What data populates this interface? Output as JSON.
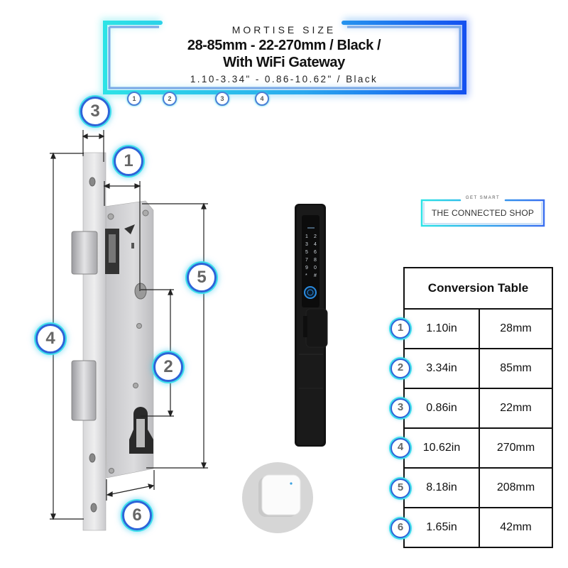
{
  "header": {
    "subtitle": "MORTISE SIZE",
    "title_line1": "28-85mm - 22-270mm / Black /",
    "title_line2": "With WiFi Gateway",
    "inch_line": "1.10-3.34\" - 0.86-10.62\" / Black",
    "mini_badges": [
      "1",
      "2",
      "3",
      "4"
    ],
    "frame_colors": {
      "left": "#2de3e6",
      "right": "#1552f0",
      "inner": "#6fa6e8"
    }
  },
  "logo": {
    "tagline": "GET SMART",
    "name": "THE CONNECTED SHOP"
  },
  "diagram": {
    "badges": [
      "1",
      "2",
      "3",
      "4",
      "5",
      "6"
    ],
    "images": {
      "mortise_lock": "mortise-lock-body",
      "smart_lock": "black-keypad-fingerprint-smart-lock",
      "gateway": "white-wifi-gateway"
    },
    "keypad_keys": [
      "1",
      "2",
      "3",
      "4",
      "5",
      "6",
      "7",
      "8",
      "9",
      "0",
      "*",
      "#"
    ]
  },
  "conversion_table": {
    "title": "Conversion Table",
    "rows": [
      {
        "badge": "1",
        "inches": "1.10in",
        "mm": "28mm"
      },
      {
        "badge": "2",
        "inches": "3.34in",
        "mm": "85mm"
      },
      {
        "badge": "3",
        "inches": "0.86in",
        "mm": "22mm"
      },
      {
        "badge": "4",
        "inches": "10.62in",
        "mm": "270mm"
      },
      {
        "badge": "5",
        "inches": "8.18in",
        "mm": "208mm"
      },
      {
        "badge": "6",
        "inches": "1.65in",
        "mm": "42mm"
      }
    ]
  }
}
